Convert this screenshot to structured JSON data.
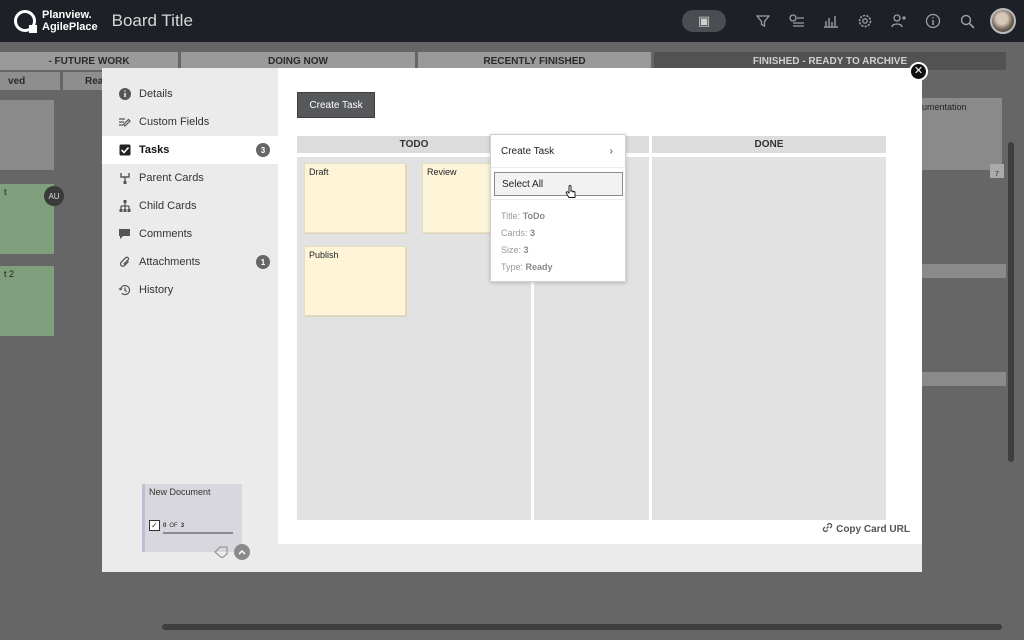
{
  "app": {
    "logo_line1": "Planview.",
    "logo_line2": "AgilePlace",
    "board_title": "Board Title"
  },
  "toolbar": {
    "icons": [
      "card-add-icon",
      "filter-icon",
      "timeline-icon",
      "analytics-icon",
      "settings-icon",
      "add-user-icon",
      "info-icon",
      "search-icon",
      "avatar"
    ]
  },
  "board": {
    "lanes": [
      {
        "label": "- FUTURE WORK"
      },
      {
        "label": "DOING NOW"
      },
      {
        "label": "RECENTLY FINISHED"
      },
      {
        "label": "FINISHED - READY TO ARCHIVE"
      }
    ],
    "sub_lanes": [
      "ved",
      "Rea"
    ],
    "bg_texts": {
      "doc": "umentation",
      "t2": "t 2",
      "t": "t",
      "avatar_initials": "AU",
      "date": "7"
    }
  },
  "modal": {
    "nav": [
      {
        "label": "Details",
        "icon": "info-circle-icon"
      },
      {
        "label": "Custom Fields",
        "icon": "pencil-lines-icon"
      },
      {
        "label": "Tasks",
        "icon": "checkbox-icon",
        "badge": "3",
        "active": true
      },
      {
        "label": "Parent Cards",
        "icon": "parent-tree-icon"
      },
      {
        "label": "Child Cards",
        "icon": "child-tree-icon"
      },
      {
        "label": "Comments",
        "icon": "comment-icon"
      },
      {
        "label": "Attachments",
        "icon": "paperclip-icon",
        "badge": "1"
      },
      {
        "label": "History",
        "icon": "history-icon"
      }
    ],
    "mini_card": {
      "title": "New Document",
      "progress_done": "0",
      "progress_of": "OF",
      "progress_total": "3"
    },
    "create_task_label": "Create Task",
    "columns": [
      {
        "label": "TODO"
      },
      {
        "label": ""
      },
      {
        "label": "DONE"
      }
    ],
    "tasks": [
      {
        "label": "Draft"
      },
      {
        "label": "Review"
      },
      {
        "label": "Publish"
      }
    ],
    "context_menu": {
      "create_task": "Create Task",
      "arrow": "›",
      "select_all": "Select All",
      "info": [
        {
          "key": "Title:",
          "value": "ToDo"
        },
        {
          "key": "Cards:",
          "value": "3"
        },
        {
          "key": "Size:",
          "value": "3"
        },
        {
          "key": "Type:",
          "value": "Ready"
        }
      ]
    },
    "copy_url_label": "Copy Card URL"
  },
  "colors": {
    "topbar": "#1d2026",
    "task_card": "#fef4d8",
    "button_dark": "#56585b"
  }
}
